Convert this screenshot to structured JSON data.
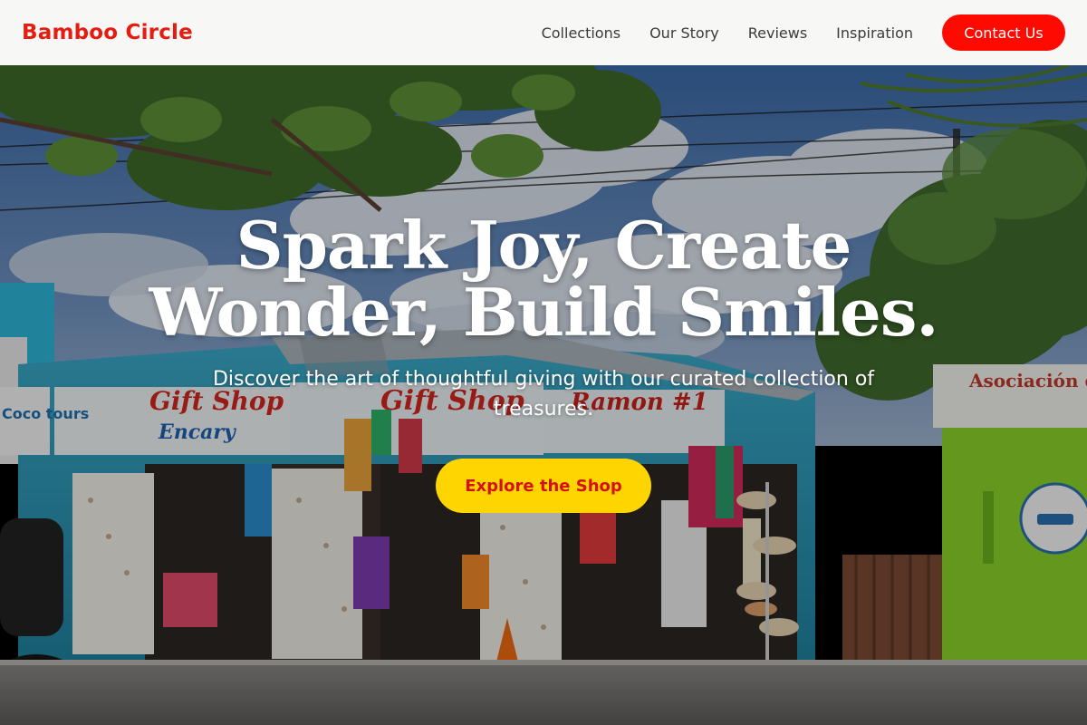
{
  "header": {
    "brand": "Bamboo Circle",
    "nav": [
      "Collections",
      "Our Story",
      "Reviews",
      "Inspiration"
    ],
    "contact_label": "Contact Us"
  },
  "hero": {
    "headline": "Spark Joy, Create Wonder, Build Smiles.",
    "subtitle": "Discover the art of thoughtful giving with our curated collection of treasures.",
    "cta_label": "Explore the Shop",
    "photo_signs": {
      "left_sign": "Gift Shop",
      "left_sign_sub": "Encary",
      "middle_sign": "Gift Shop",
      "right_sign": "Ramon #1",
      "far_left_sign": "Coco tours",
      "far_right_sign": "Asociación de tr"
    }
  },
  "colors": {
    "brand": "#e51c10",
    "contact_button": "#ff0a00",
    "cta_button": "#ffd500",
    "cta_text": "#d41212",
    "header_bg": "#f7f7f6"
  }
}
